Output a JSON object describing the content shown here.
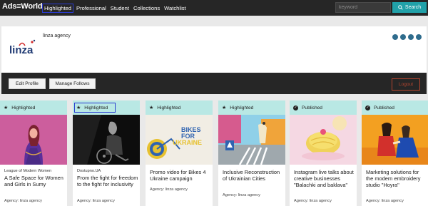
{
  "nav": {
    "logo": "Ads≡World",
    "links": [
      "Highlighted",
      "Professional",
      "Student",
      "Collections",
      "Watchlist"
    ],
    "search_placeholder": "keyword",
    "search_button": "Search"
  },
  "profile": {
    "logo_text": "linza",
    "name": "linza agency",
    "social_icons": [
      "globe-icon",
      "linkedin-icon",
      "facebook-icon",
      "instagram-icon"
    ]
  },
  "actions": {
    "edit_profile": "Edit Profile",
    "manage_follows": "Manage Follows",
    "logout": "Logout"
  },
  "cards": [
    {
      "tag": "Highlighted",
      "tag_icon": "star-icon",
      "source": "League of Modern Women",
      "title": "A Safe Space for Women and Girls in Sumy",
      "agency": "Agency: linza agency"
    },
    {
      "tag": "Highlighted",
      "tag_icon": "star-icon",
      "source": "Dostupno.UA",
      "title": "From the fight for freedom to the fight for inclusivity",
      "agency": "Agency: linza agency"
    },
    {
      "tag": "Highlighted",
      "tag_icon": "star-icon",
      "source": "",
      "title": "Promo video for Bikes 4 Ukraine campaign",
      "agency": "Agency: linza agency",
      "image_text": [
        "BIKES",
        "FOR",
        "UKRAINE"
      ]
    },
    {
      "tag": "Highlighted",
      "tag_icon": "star-icon",
      "source": "",
      "title": "Inclusive Reconstruction of Ukrainian Cities",
      "agency": "Agency: linza agency"
    },
    {
      "tag": "Published",
      "tag_icon": "check-circle-icon",
      "source": "",
      "title": "Instagram live talks about creative businesses \"Balachki and baklava\"",
      "agency": "Agency: linza agency"
    },
    {
      "tag": "Published",
      "tag_icon": "check-circle-icon",
      "source": "",
      "title": "Marketing solutions for the modern embroidery studio \"Hoyra\"",
      "agency": "Agency: linza agency"
    }
  ],
  "colors": {
    "nav_bg": "#262626",
    "accent_teal": "#21a1a9",
    "tag_bg": "#b9e8e4",
    "highlight_border": "#2a3bd0",
    "logout_red": "#b5452e",
    "social_blue": "#2f6c8d"
  }
}
